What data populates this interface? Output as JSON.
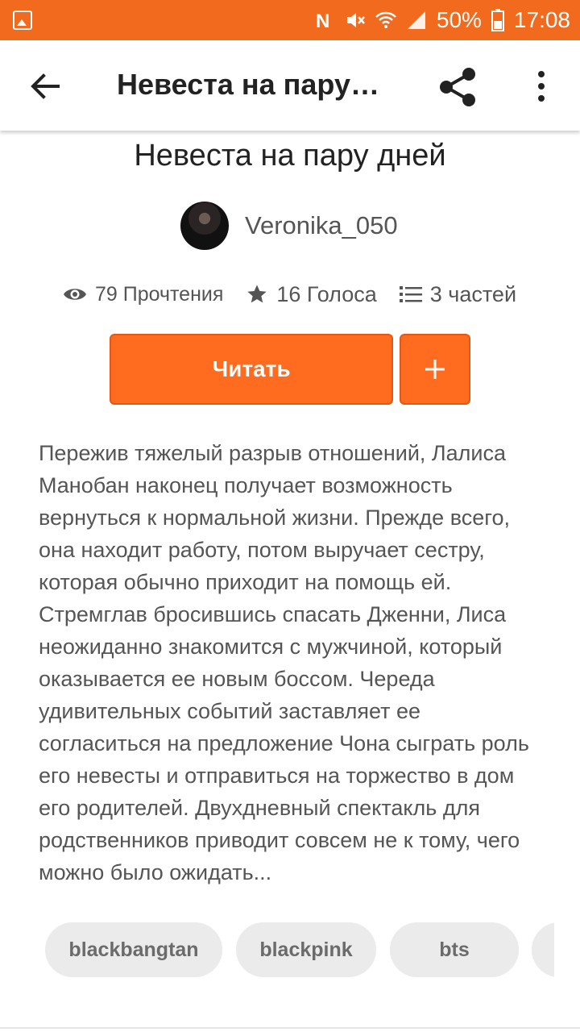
{
  "status_bar": {
    "battery": "50%",
    "time": "17:08",
    "icons": [
      "gallery-icon",
      "n-icon",
      "mute-icon",
      "wifi-icon",
      "signal-icon",
      "battery-icon"
    ],
    "color": "#f26a1d"
  },
  "app_bar": {
    "title": "Невеста на пару…",
    "icons": [
      "back-arrow-icon",
      "share-icon",
      "more-vert-icon"
    ]
  },
  "story": {
    "title": "Невеста на пару дней",
    "author": "Veronika_050",
    "stats": {
      "reads": "79 Прочтения",
      "votes": "16 Голоса",
      "parts": "3 частей"
    },
    "read_button": "Читать",
    "add_button_icon": "plus-icon",
    "description": "Пережив тяжелый разрыв отношений, Лалиса Манобан наконец получает возможность вернуться к нормальной жизни. Прежде всего, она находит работу, потом выручает сестру, которая обычно приходит на помощь ей. Стремглав бросившись спасать Дженни, Лиса неожиданно знакомится с мужчиной, который оказывается ее новым боссом. Череда удивительных событий заставляет ее согласиться на предложение Чона сыграть роль его невесты и отправиться на торжество в дом его родителей. Двухдневный спектакль для родственников приводит совсем не к тому, чего можно было ожидать...",
    "tags": [
      "blackbangtan",
      "blackpink",
      "bts"
    ]
  },
  "colors": {
    "accent": "#ff6c1f",
    "tag_bg": "#ebebeb"
  }
}
